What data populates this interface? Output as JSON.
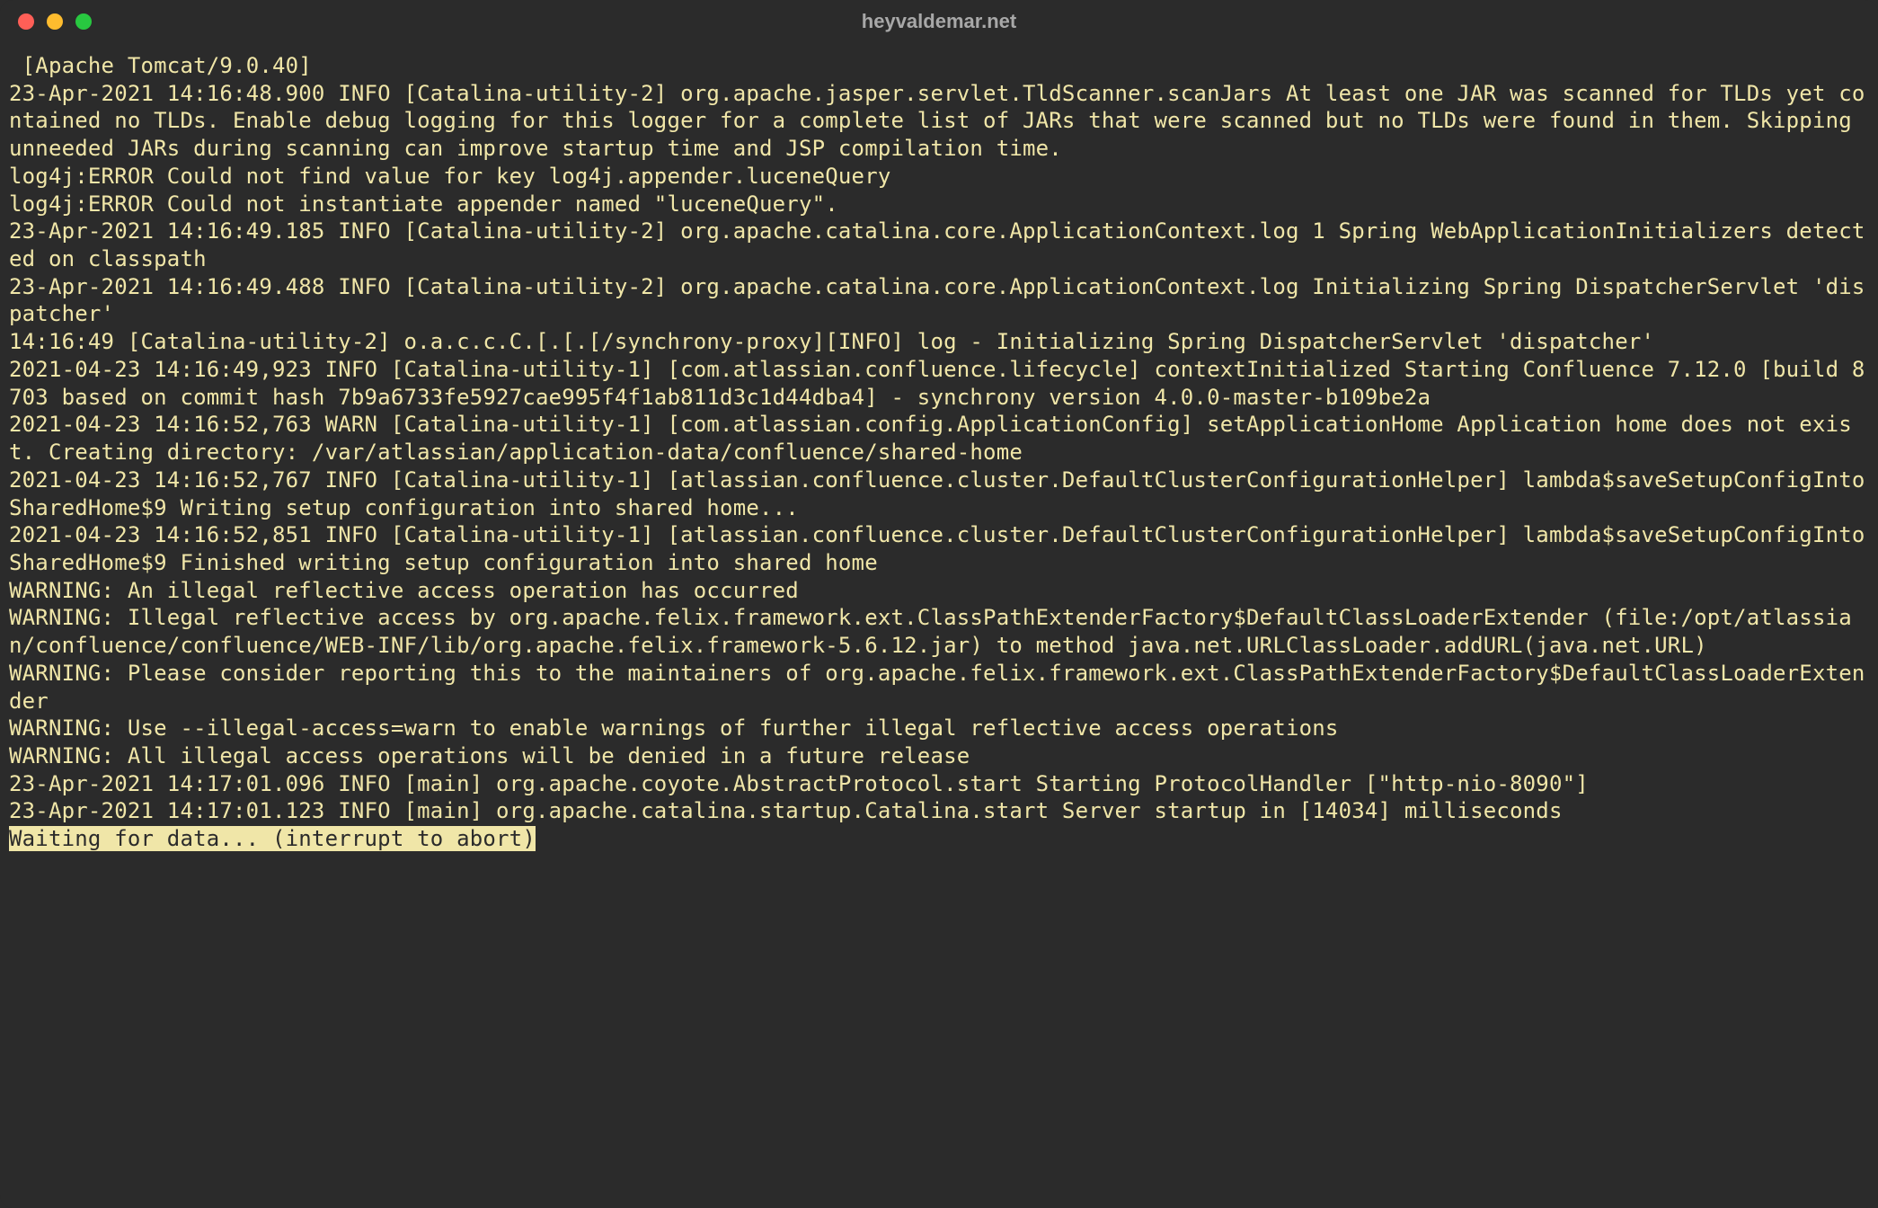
{
  "window": {
    "title": "heyvaldemar.net"
  },
  "terminal": {
    "lines": [
      " [Apache Tomcat/9.0.40]",
      "23-Apr-2021 14:16:48.900 INFO [Catalina-utility-2] org.apache.jasper.servlet.TldScanner.scanJars At least one JAR was scanned for TLDs yet contained no TLDs. Enable debug logging for this logger for a complete list of JARs that were scanned but no TLDs were found in them. Skipping unneeded JARs during scanning can improve startup time and JSP compilation time.",
      "log4j:ERROR Could not find value for key log4j.appender.luceneQuery",
      "log4j:ERROR Could not instantiate appender named \"luceneQuery\".",
      "23-Apr-2021 14:16:49.185 INFO [Catalina-utility-2] org.apache.catalina.core.ApplicationContext.log 1 Spring WebApplicationInitializers detected on classpath",
      "23-Apr-2021 14:16:49.488 INFO [Catalina-utility-2] org.apache.catalina.core.ApplicationContext.log Initializing Spring DispatcherServlet 'dispatcher'",
      "14:16:49 [Catalina-utility-2] o.a.c.c.C.[.[.[/synchrony-proxy][INFO] log - Initializing Spring DispatcherServlet 'dispatcher'",
      "2021-04-23 14:16:49,923 INFO [Catalina-utility-1] [com.atlassian.confluence.lifecycle] contextInitialized Starting Confluence 7.12.0 [build 8703 based on commit hash 7b9a6733fe5927cae995f4f1ab811d3c1d44dba4] - synchrony version 4.0.0-master-b109be2a",
      "2021-04-23 14:16:52,763 WARN [Catalina-utility-1] [com.atlassian.config.ApplicationConfig] setApplicationHome Application home does not exist. Creating directory: /var/atlassian/application-data/confluence/shared-home",
      "2021-04-23 14:16:52,767 INFO [Catalina-utility-1] [atlassian.confluence.cluster.DefaultClusterConfigurationHelper] lambda$saveSetupConfigIntoSharedHome$9 Writing setup configuration into shared home...",
      "2021-04-23 14:16:52,851 INFO [Catalina-utility-1] [atlassian.confluence.cluster.DefaultClusterConfigurationHelper] lambda$saveSetupConfigIntoSharedHome$9 Finished writing setup configuration into shared home",
      "WARNING: An illegal reflective access operation has occurred",
      "WARNING: Illegal reflective access by org.apache.felix.framework.ext.ClassPathExtenderFactory$DefaultClassLoaderExtender (file:/opt/atlassian/confluence/confluence/WEB-INF/lib/org.apache.felix.framework-5.6.12.jar) to method java.net.URLClassLoader.addURL(java.net.URL)",
      "WARNING: Please consider reporting this to the maintainers of org.apache.felix.framework.ext.ClassPathExtenderFactory$DefaultClassLoaderExtender",
      "WARNING: Use --illegal-access=warn to enable warnings of further illegal reflective access operations",
      "WARNING: All illegal access operations will be denied in a future release",
      "23-Apr-2021 14:17:01.096 INFO [main] org.apache.coyote.AbstractProtocol.start Starting ProtocolHandler [\"http-nio-8090\"]",
      "23-Apr-2021 14:17:01.123 INFO [main] org.apache.catalina.startup.Catalina.start Server startup in [14034] milliseconds"
    ],
    "prompt_line": "Waiting for data... (interrupt to abort)"
  }
}
